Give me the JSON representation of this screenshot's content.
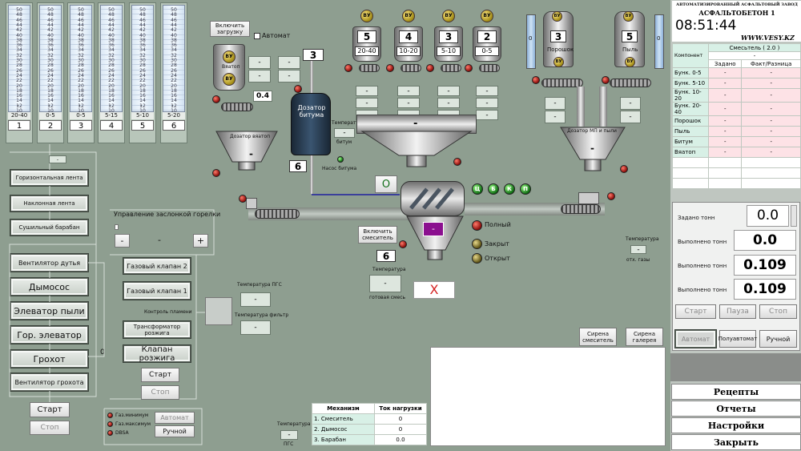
{
  "silos": [
    {
      "label": "20-40",
      "num": "1"
    },
    {
      "label": "0-5",
      "num": "2"
    },
    {
      "label": "0-5",
      "num": "3"
    },
    {
      "label": "5-15",
      "num": "4"
    },
    {
      "label": "5-10",
      "num": "5"
    },
    {
      "label": "5-20",
      "num": "6"
    }
  ],
  "silo_ticks": [
    "50",
    "48",
    "46",
    "44",
    "42",
    "40",
    "38",
    "36",
    "34",
    "32",
    "30",
    "28",
    "26",
    "24",
    "22",
    "20",
    "18",
    "16",
    "14",
    "12",
    "10"
  ],
  "silo_marker": "-",
  "left_buttons": {
    "horizontal_belt": "Горизонтальная лента",
    "inclined_belt": "Наклонная лента",
    "drying_drum": "Сушильный барабан",
    "blower_fan": "Вентилятор дутья",
    "exhaust_fan": "Дымосос",
    "dust_elevator": "Элеватор пыли",
    "hot_elevator": "Гор. элеватор",
    "screen": "Грохот",
    "screen_fan": "Вентилятор грохота",
    "start": "Старт",
    "stop": "Стоп",
    "counter": "0"
  },
  "burner": {
    "title": "Управление заслонкой горелки",
    "value": "-",
    "minus": "-",
    "plus": "+",
    "gas_valve2": "Газовый клапан 2",
    "gas_valve1": "Газовый клапан 1",
    "flame_control": "Контроль пламени",
    "ignition_transformer": "Трансформатор розжига",
    "ignition_valve": "Клапан розжига",
    "start": "Старт",
    "stop": "Стоп",
    "gas_min": "Газ.минимум",
    "gas_max": "Газ.максимум",
    "dbsa": "DBSA",
    "auto": "Автомат",
    "manual": "Ручной"
  },
  "temps": {
    "pgs_label": "Температура ПГС",
    "pgs_value": "-",
    "filter_label": "Температура фильтр",
    "filter_value": "-",
    "bottom_label": "Температура",
    "bottom_value": "-",
    "bottom_sub": "ПГС",
    "mix_label": "Температура",
    "mix_value": "-",
    "mix_sub": "готовая смесь",
    "gas_label": "Температура",
    "gas_value": "-",
    "gas_sub": "отх. газы",
    "bitum_label": "Температура",
    "bitum_value": "-",
    "bitum_sub": "битум"
  },
  "dosers": {
    "enable_loading": "Включить загрузку",
    "auto_label": "Автомат",
    "vyatop": "Вяатоп",
    "vu": "ВУ",
    "vyatop_doser": "Дозатор вяатоп",
    "vyatop_weight": "-",
    "vyatop_value": "0.4",
    "bitumen_box": "3",
    "bitumen_doser": "Дозатор битума",
    "bitumen_pump": "Насос битума",
    "bitumen_num": "6",
    "aggregate_bins": [
      {
        "num": "5",
        "label": "20-40"
      },
      {
        "num": "4",
        "label": "10-20"
      },
      {
        "num": "3",
        "label": "5-10"
      },
      {
        "num": "2",
        "label": "0-5"
      }
    ],
    "aggregate_weight": "-",
    "mp_doser": "Дозатор МП и пыли",
    "mp_weight": "-",
    "powder_num": "3",
    "powder_label": "Порошок",
    "dust_num": "5",
    "dust_label": "Пыль",
    "silo_left": "0",
    "silo_right": "0",
    "dash": "-"
  },
  "mixer": {
    "o_label": "O",
    "indicators": [
      "Ц",
      "Б",
      "К",
      "П"
    ],
    "enable_mixer": "Включить смеситель",
    "weight": "-",
    "full": "Полный",
    "closed": "Закрыт",
    "open": "Открыт",
    "num": "6",
    "stop_symbol": "X",
    "siren_mixer": "Сирена смеситель",
    "siren_gallery": "Сирена галерея"
  },
  "mechanism_table": {
    "headers": [
      "Механизм",
      "Ток нагрузки"
    ],
    "rows": [
      [
        "1. Смеситель",
        "0"
      ],
      [
        "2. Дымосос",
        "0"
      ],
      [
        "3. Барабан",
        "0.0"
      ]
    ]
  },
  "right_panel": {
    "company_line1": "АВТОМАТИЗИРОВАННЫЙ АСФАЛЬТОВЫЙ ЗАВОД",
    "company_line2": "АСФАЛЬТОБЕТОН 1",
    "clock": "08:51:44",
    "website": "WWW.VESY.KZ",
    "mix_header": "Смесьтель ( 2.0 )",
    "mix_sub": "-",
    "component_label": "Компонент",
    "col_set": "Задано",
    "col_fact": "Факт/Разница",
    "components": [
      "Бунк. 0-5",
      "Бунк. 5-10",
      "Бунк. 10-20",
      "Бунк. 20-40",
      "Порошок",
      "Пыль",
      "Битум",
      "Вяатоп"
    ],
    "comp_set": [
      "-",
      "-",
      "-",
      "-",
      "-",
      "-",
      "-",
      "-"
    ],
    "comp_fact": [
      "-",
      "-",
      "-",
      "-",
      "-",
      "-",
      "-",
      "-"
    ],
    "set_tons_label": "Задано тонн",
    "set_tons_value": "0.0",
    "done1_label": "Выполнено тонн",
    "done1_value": "0.0",
    "done2_label": "Выполнено тонн",
    "done2_value": "0.109",
    "done3_label": "Выполнено тонн",
    "done3_value": "0.109",
    "start": "Старт",
    "pause": "Пауза",
    "stop": "Стоп",
    "auto": "Автомат",
    "semi_auto": "Полуавтомат",
    "manual": "Ручной",
    "menu": [
      "Рецепты",
      "Отчеты",
      "Настройки",
      "Закрыть"
    ]
  },
  "colors": {
    "background": "#8e9e90",
    "mix_header_bg": "#d8f0e6",
    "component_bg": "#d8f0e6",
    "fact_bg": "#fde2e6",
    "mixer_product": "#8b0f8f",
    "stop_red": "#d42020"
  }
}
